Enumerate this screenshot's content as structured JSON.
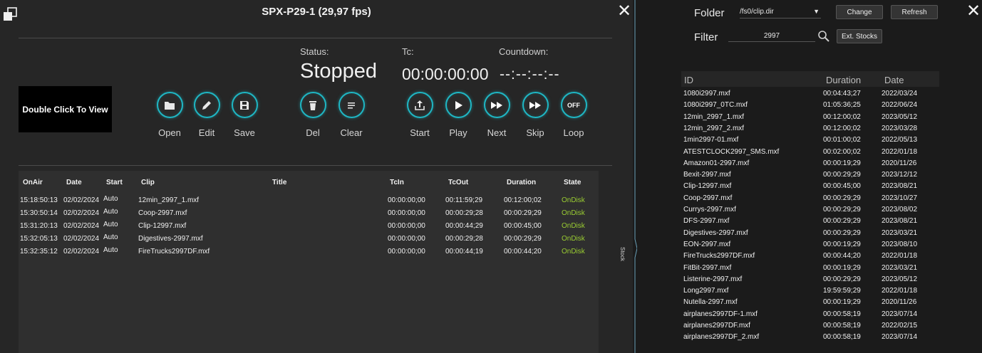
{
  "player": {
    "title": "SPX-P29-1 (29,97 fps)",
    "preview_text": "Double Click To View",
    "status_label": "Status:",
    "status_value": "Stopped",
    "tc_label": "Tc:",
    "tc_value": "00:00:00:00",
    "countdown_label": "Countdown:",
    "countdown_value": "--:--:--:--",
    "buttons": {
      "open": "Open",
      "edit": "Edit",
      "save": "Save",
      "del": "Del",
      "clear": "Clear",
      "start": "Start",
      "play": "Play",
      "next": "Next",
      "skip": "Skip",
      "loop": "Loop",
      "loop_icon_text": "OFF"
    },
    "accent_color": "#1fb7c4",
    "playlist": {
      "headers": {
        "onair": "OnAir",
        "date": "Date",
        "start": "Start",
        "clip": "Clip",
        "title": "Title",
        "tcin": "TcIn",
        "tcout": "TcOut",
        "duration": "Duration",
        "state": "State"
      },
      "rows": [
        {
          "onair": "15:18:50:13",
          "date": "02/02/2024",
          "start": "Auto",
          "clip": "12min_2997_1.mxf",
          "title": "",
          "tcin": "00:00:00;00",
          "tcout": "00:11:59;29",
          "duration": "00:12:00;02",
          "state": "OnDisk"
        },
        {
          "onair": "15:30:50:14",
          "date": "02/02/2024",
          "start": "Auto",
          "clip": "Coop-2997.mxf",
          "title": "",
          "tcin": "00:00:00;00",
          "tcout": "00:00:29;28",
          "duration": "00:00:29;29",
          "state": "OnDisk"
        },
        {
          "onair": "15:31:20:13",
          "date": "02/02/2024",
          "start": "Auto",
          "clip": "Clip-12997.mxf",
          "title": "",
          "tcin": "00:00:00;00",
          "tcout": "00:00:44;29",
          "duration": "00:00:45;00",
          "state": "OnDisk"
        },
        {
          "onair": "15:32:05:13",
          "date": "02/02/2024",
          "start": "Auto",
          "clip": "Digestives-2997.mxf",
          "title": "",
          "tcin": "00:00:00;00",
          "tcout": "00:00:29;28",
          "duration": "00:00:29;29",
          "state": "OnDisk"
        },
        {
          "onair": "15:32:35:12",
          "date": "02/02/2024",
          "start": "Auto",
          "clip": "FireTrucks2997DF.mxf",
          "title": "",
          "tcin": "00:00:00;00",
          "tcout": "00:00:44;19",
          "duration": "00:00:44;20",
          "state": "OnDisk"
        }
      ]
    }
  },
  "stock_tab": {
    "label": "Stock"
  },
  "stock": {
    "folder_label": "Folder",
    "folder_value": "/fs0/clip.dir",
    "change_label": "Change",
    "refresh_label": "Refresh",
    "filter_label": "Filter",
    "filter_value": "2997",
    "ext_stocks_label": "Ext. Stocks",
    "headers": {
      "id": "ID",
      "duration": "Duration",
      "date": "Date"
    },
    "rows": [
      {
        "id": "1080i2997.mxf",
        "duration": "00:04:43;27",
        "date": "2022/03/24"
      },
      {
        "id": "1080i2997_0TC.mxf",
        "duration": "01:05:36;25",
        "date": "2022/06/24"
      },
      {
        "id": "12min_2997_1.mxf",
        "duration": "00:12:00;02",
        "date": "2023/05/12"
      },
      {
        "id": "12min_2997_2.mxf",
        "duration": "00:12:00;02",
        "date": "2023/03/28"
      },
      {
        "id": "1min2997-01.mxf",
        "duration": "00:01:00;02",
        "date": "2022/05/13"
      },
      {
        "id": "ATESTCLOCK2997_SMS.mxf",
        "duration": "00:02:00;02",
        "date": "2022/01/18"
      },
      {
        "id": "Amazon01-2997.mxf",
        "duration": "00:00:19;29",
        "date": "2020/11/26"
      },
      {
        "id": "Bexit-2997.mxf",
        "duration": "00:00:29;29",
        "date": "2023/12/12"
      },
      {
        "id": "Clip-12997.mxf",
        "duration": "00:00:45;00",
        "date": "2023/08/21"
      },
      {
        "id": "Coop-2997.mxf",
        "duration": "00:00:29;29",
        "date": "2023/10/27"
      },
      {
        "id": "Currys-2997.mxf",
        "duration": "00:00:29;29",
        "date": "2023/08/02"
      },
      {
        "id": "DFS-2997.mxf",
        "duration": "00:00:29;29",
        "date": "2023/08/21"
      },
      {
        "id": "Digestives-2997.mxf",
        "duration": "00:00:29;29",
        "date": "2023/03/21"
      },
      {
        "id": "EON-2997.mxf",
        "duration": "00:00:19;29",
        "date": "2023/08/10"
      },
      {
        "id": "FireTrucks2997DF.mxf",
        "duration": "00:00:44;20",
        "date": "2022/01/18"
      },
      {
        "id": "FitBit-2997.mxf",
        "duration": "00:00:19;29",
        "date": "2023/03/21"
      },
      {
        "id": "Listerine-2997.mxf",
        "duration": "00:00:29;29",
        "date": "2023/05/12"
      },
      {
        "id": "Long2997.mxf",
        "duration": "19:59:59;29",
        "date": "2022/01/18"
      },
      {
        "id": "Nutella-2997.mxf",
        "duration": "00:00:19;29",
        "date": "2020/11/26"
      },
      {
        "id": "airplanes2997DF-1.mxf",
        "duration": "00:00:58;19",
        "date": "2023/07/14"
      },
      {
        "id": "airplanes2997DF.mxf",
        "duration": "00:00:58;19",
        "date": "2022/02/15"
      },
      {
        "id": "airplanes2997DF_2.mxf",
        "duration": "00:00:58;19",
        "date": "2023/07/14"
      }
    ]
  }
}
